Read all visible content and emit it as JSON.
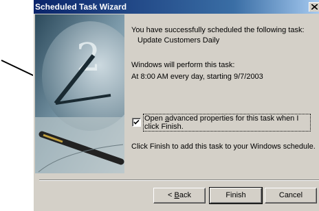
{
  "window": {
    "title": "Scheduled Task Wizard"
  },
  "content": {
    "success_line": "You have successfully scheduled the following task:",
    "task_name": "Update Customers Daily",
    "perform_line": "Windows will perform this task:",
    "schedule_line": "At 8:00 AM every day, starting 9/7/2003",
    "checkbox_label_prefix": "Open ",
    "checkbox_label_mnemonic": "a",
    "checkbox_label_rest": "dvanced properties for this task when I click Finish.",
    "checkbox_checked": true,
    "finish_hint": "Click Finish to add this task to your Windows schedule."
  },
  "buttons": {
    "back_prefix": "< ",
    "back_mnemonic": "B",
    "back_rest": "ack",
    "finish": "Finish",
    "cancel": "Cancel"
  },
  "icons": {
    "close": "close-icon",
    "checkmark": "checkmark-icon",
    "clock": "wizard-clock-image"
  },
  "colors": {
    "titlebar_start": "#0a246a",
    "titlebar_end": "#a6caf0",
    "dialog_face": "#d4d0c8"
  }
}
